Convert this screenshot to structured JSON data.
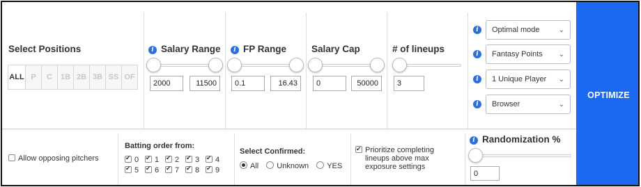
{
  "positions": {
    "title": "Select Positions",
    "buttons": [
      "ALL",
      "P",
      "C",
      "1B",
      "2B",
      "3B",
      "SS",
      "OF"
    ],
    "selected": "ALL"
  },
  "salary_range": {
    "title": "Salary Range",
    "min": "2000",
    "max": "11500",
    "slider_min": 0.0,
    "slider_max": 1.0
  },
  "fp_range": {
    "title": "FP Range",
    "min": "0.1",
    "max": "16.43",
    "slider_min": 0.0,
    "slider_max": 1.0
  },
  "salary_cap": {
    "title": "Salary Cap",
    "min": "0",
    "max": "50000",
    "slider_min": 0.0,
    "slider_max": 1.0
  },
  "lineups": {
    "title": "# of lineups",
    "value": "3",
    "slider_value": 0.0
  },
  "dropdowns": [
    {
      "value": "Optimal mode"
    },
    {
      "value": "Fantasy Points"
    },
    {
      "value": "1 Unique Player"
    },
    {
      "value": "Browser"
    }
  ],
  "optimize_label": "OPTIMIZE",
  "allow_opposing": {
    "label": "Allow opposing pitchers",
    "checked": false
  },
  "batting_order": {
    "title": "Batting order from:",
    "items": [
      "0",
      "1",
      "2",
      "3",
      "4",
      "5",
      "6",
      "7",
      "8",
      "9"
    ]
  },
  "confirmed": {
    "title": "Select Confirmed:",
    "options": [
      "All",
      "Unknown",
      "YES"
    ],
    "selected": "All"
  },
  "prioritize": {
    "line1": "Prioritize completing",
    "line2": "lineups above max",
    "line3": "exposure settings",
    "checked": true
  },
  "randomization": {
    "title": "Randomization %",
    "value": "0",
    "slider_value": 0.0
  },
  "colors": {
    "accent": "#1a69f0",
    "info": "#2c6fd6"
  },
  "icons": {
    "info": "info-icon",
    "select": "chevron-down-icon"
  }
}
